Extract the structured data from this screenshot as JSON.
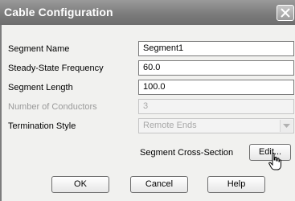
{
  "dialog": {
    "title": "Cable Configuration",
    "close_icon": "close-icon"
  },
  "fields": {
    "segment_name": {
      "label": "Segment Name",
      "value": "Segment1"
    },
    "frequency": {
      "label": "Steady-State Frequency",
      "value": "60.0"
    },
    "length": {
      "label": "Segment Length",
      "value": "100.0"
    },
    "conductors": {
      "label": "Number of Conductors",
      "value": "3"
    },
    "termination": {
      "label": "Termination Style",
      "value": "Remote Ends"
    },
    "cross_section": {
      "label": "Segment Cross-Section"
    }
  },
  "buttons": {
    "edit": "Edit...",
    "ok": "OK",
    "cancel": "Cancel",
    "help": "Help"
  },
  "icons": {
    "dropdown": "chevron-down-icon",
    "cursor": "hand-pointer-icon"
  },
  "colors": {
    "titlebar": "#7a7a7a",
    "dialog_bg": "#f1f1ef",
    "disabled_text": "#9a9a9a"
  }
}
